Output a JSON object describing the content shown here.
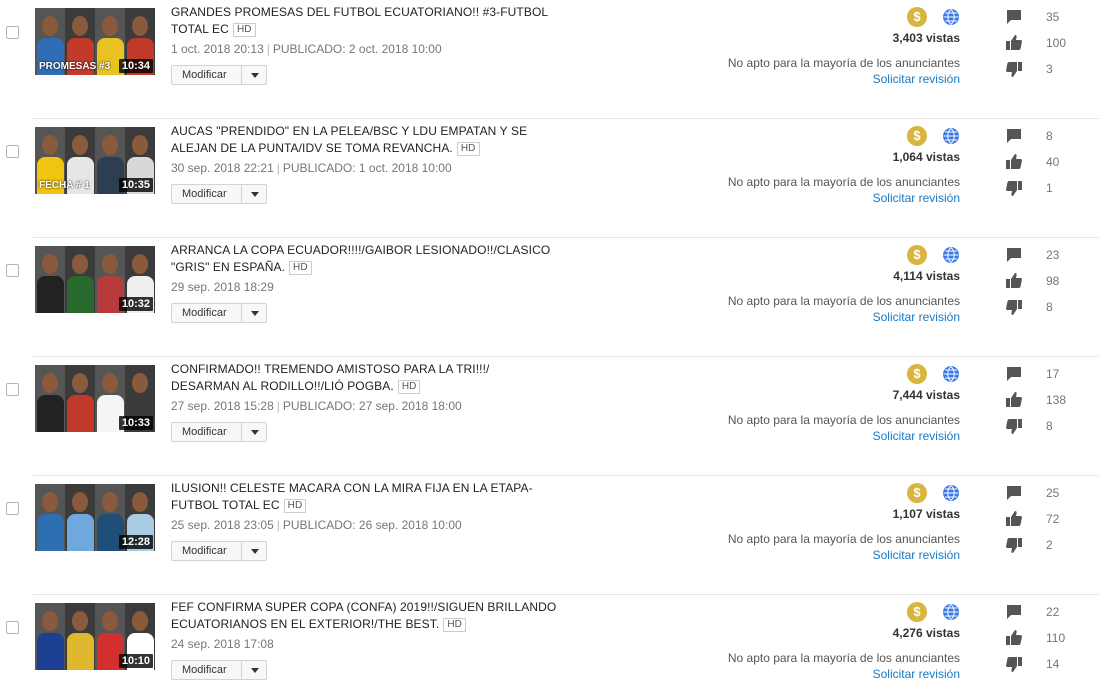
{
  "ui": {
    "edit_label": "Modificar",
    "views_suffix": "vistas",
    "ads_status": "No apto para la mayoría de los anunciantes",
    "review_label": "Solicitar revisión",
    "hd_badge": "HD",
    "money_symbol": "$"
  },
  "colors": {
    "money": "#d9b43e",
    "globe": "#3b78e7",
    "link": "#167ac6",
    "icon_gray": "#555555"
  },
  "videos": [
    {
      "title": "GRANDES PROMESAS DEL FUTBOL ECUATORIANO!! #3-FUTBOL TOTAL EC",
      "recorded": "1 oct. 2018 20:13",
      "published": "PUBLICADO: 2 oct. 2018 10:00",
      "duration": "10:34",
      "thumb_text": "PROMESAS #3",
      "views": "3,403",
      "comments": "35",
      "likes": "100",
      "dislikes": "3"
    },
    {
      "title": "AUCAS \"PRENDIDO\" EN LA PELEA/BSC Y LDU EMPATAN Y SE ALEJAN DE LA PUNTA/IDV SE TOMA REVANCHA.",
      "recorded": "30 sep. 2018 22:21",
      "published": "PUBLICADO: 1 oct. 2018 10:00",
      "duration": "10:35",
      "thumb_text": "FECHA # 1",
      "views": "1,064",
      "comments": "8",
      "likes": "40",
      "dislikes": "1"
    },
    {
      "title": "ARRANCA LA COPA ECUADOR!!!!/GAIBOR LESIONADO!!/CLASICO \"GRIS\" EN ESPAÑA.",
      "recorded": "29 sep. 2018 18:29",
      "published": "",
      "duration": "10:32",
      "thumb_text": "",
      "views": "4,114",
      "comments": "23",
      "likes": "98",
      "dislikes": "8"
    },
    {
      "title": "CONFIRMADO!! TREMENDO AMISTOSO PARA LA TRI!!!/ DESARMAN AL RODILLO!!/LIÓ POGBA.",
      "recorded": "27 sep. 2018 15:28",
      "published": "PUBLICADO: 27 sep. 2018 18:00",
      "duration": "10:33",
      "thumb_text": "",
      "views": "7,444",
      "comments": "17",
      "likes": "138",
      "dislikes": "8"
    },
    {
      "title": "ILUSION!! CELESTE MACARA CON LA MIRA FIJA EN LA ETAPA-FUTBOL TOTAL EC",
      "recorded": "25 sep. 2018 23:05",
      "published": "PUBLICADO: 26 sep. 2018 10:00",
      "duration": "12:28",
      "thumb_text": "",
      "views": "1,107",
      "comments": "25",
      "likes": "72",
      "dislikes": "2"
    },
    {
      "title": "FEF CONFIRMA SUPER COPA (CONFA) 2019!!/SIGUEN BRILLANDO ECUATORIANOS EN EL EXTERIOR!/THE BEST.",
      "recorded": "24 sep. 2018 17:08",
      "published": "",
      "duration": "10:10",
      "thumb_text": "",
      "views": "4,276",
      "comments": "22",
      "likes": "110",
      "dislikes": "14"
    }
  ]
}
